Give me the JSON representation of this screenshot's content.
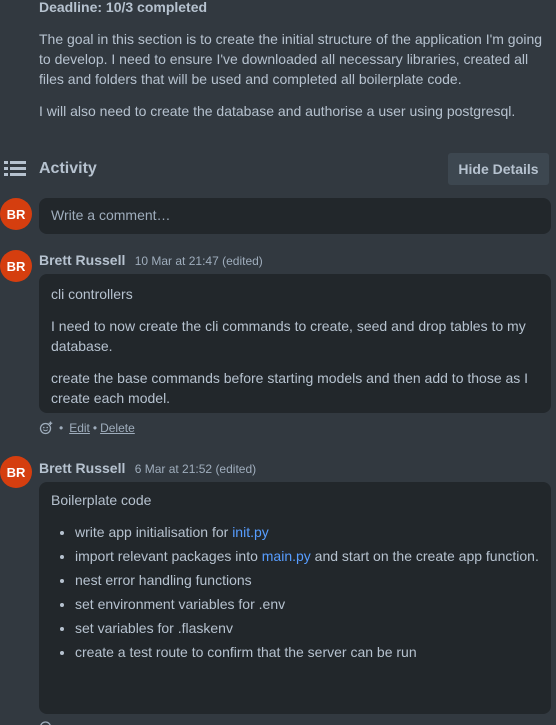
{
  "description": {
    "deadline": "Deadline: 10/3 completed",
    "para1": "The goal in this section is to create the initial structure of the application I'm going to develop. I need to ensure I've downloaded all necessary libraries, created all files and folders that will be used and completed all boilerplate code.",
    "para2": "I will also need to create the database and authorise a user using postgresql."
  },
  "activity": {
    "title": "Activity",
    "hide_details": "Hide Details",
    "comment_placeholder": "Write a comment…",
    "avatar_initials": "BR"
  },
  "comments": [
    {
      "initials": "BR",
      "author": "Brett Russell",
      "timestamp": "10 Mar at 21:47",
      "edited": "(edited)",
      "lines": [
        "cli controllers",
        "I need to now create the cli commands to create, seed and drop tables to my database.",
        "create the base commands before starting models and then add to those as I create each model."
      ],
      "actions": {
        "sep": "•",
        "edit": "Edit",
        "dot": "•",
        "delete": "Delete"
      }
    },
    {
      "initials": "BR",
      "author": "Brett Russell",
      "timestamp": "6 Mar at 21:52",
      "edited": "(edited)",
      "heading": "Boilerplate code",
      "bullets": {
        "b1_pre": "write app initialisation for ",
        "b1_link": "init.py",
        "b2_pre": "import relevant packages into ",
        "b2_link": "main.py",
        "b2_post": " and start on the create app function.",
        "b3": "nest error handling functions",
        "b4": "set environment variables for .env",
        "b5": "set variables for .flaskenv",
        "b6": "create a test route to confirm that the server can be run"
      }
    }
  ],
  "colors": {
    "background": "#323940",
    "card": "#22272b",
    "avatar": "#d53e0f",
    "link": "#579dff",
    "text": "#b6c2cf"
  }
}
